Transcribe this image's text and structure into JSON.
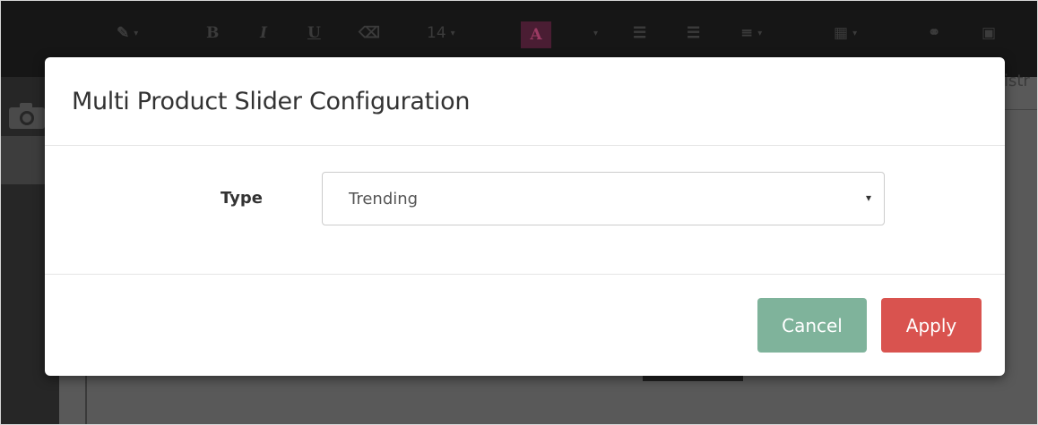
{
  "toolbar": {
    "items": [
      {
        "icon": "magic-wand-icon",
        "glyph": "✎",
        "caret": "▾"
      },
      {
        "icon": "bold-icon",
        "glyph": "B"
      },
      {
        "icon": "italic-icon",
        "glyph": "I"
      },
      {
        "icon": "underline-icon",
        "glyph": "U"
      },
      {
        "icon": "eraser-icon",
        "glyph": "⌫"
      },
      {
        "icon": "font-size-icon",
        "glyph": "14",
        "caret": "▾"
      },
      {
        "icon": "font-color-icon",
        "glyph": "A",
        "caret": "▾"
      },
      {
        "icon": "unordered-list-icon",
        "glyph": "☰"
      },
      {
        "icon": "ordered-list-icon",
        "glyph": "☰"
      },
      {
        "icon": "align-icon",
        "glyph": "≡",
        "caret": "▾"
      },
      {
        "icon": "table-icon",
        "glyph": "▦",
        "caret": "▾"
      },
      {
        "icon": "link-icon",
        "glyph": "⚭"
      },
      {
        "icon": "picture-icon",
        "glyph": "▣"
      }
    ]
  },
  "background": {
    "peek_text": "istr"
  },
  "modal": {
    "title": "Multi Product Slider Configuration",
    "type_label": "Type",
    "type_select": {
      "value": "Trending",
      "caret": "▾"
    },
    "cancel_label": "Cancel",
    "apply_label": "Apply"
  },
  "colors": {
    "cancel_button": "#7fb39b",
    "apply_button": "#d9534f",
    "overlay": "#2a2a2a"
  }
}
